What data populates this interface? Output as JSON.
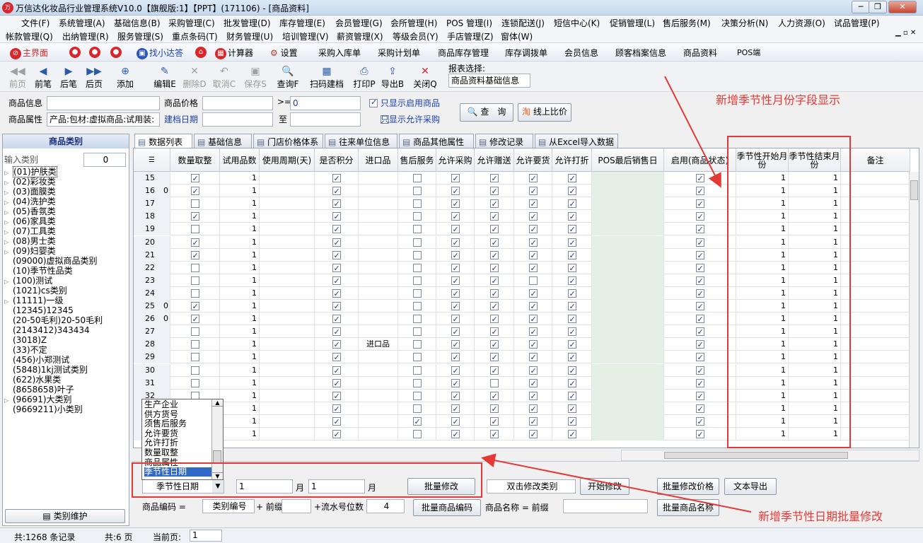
{
  "window": {
    "title": "万信达化妆品行业管理系统V10.0【旗舰版:1】【PPT】(171106) - [商品资料]"
  },
  "menu1": [
    "文件(F)",
    "系统管理(A)",
    "基础信息(B)",
    "采购管理(C)",
    "批发管理(D)",
    "库存管理(E)",
    "会员管理(G)",
    "会所管理(H)",
    "POS 管理(I)",
    "连锁配送(J)",
    "短信中心(K)",
    "促销管理(L)",
    "售后服务(M)",
    "决策分析(N)",
    "人力资源(O)",
    "试品管理(P)"
  ],
  "menu2": [
    "帐款管理(Q)",
    "出纳管理(R)",
    "服务管理(S)",
    "重点条码(T)",
    "财务管理(U)",
    "培训管理(V)",
    "薪资管理(X)",
    "等级会员(Y)",
    "手店管理(Z)",
    "窗体(W)"
  ],
  "quickbar": {
    "home": "主界面",
    "find": "找小达答",
    "calc": "计算器",
    "settings": "设置",
    "items": [
      "采购入库单",
      "采购计划单",
      "商品库存管理",
      "库存调拨单",
      "会员信息",
      "顾客档案信息",
      "商品资料",
      "POS端"
    ]
  },
  "toolbar": {
    "buttons": [
      {
        "label": "前页",
        "icon": "◀◀",
        "disabled": true
      },
      {
        "label": "前笔",
        "icon": "◀",
        "disabled": false
      },
      {
        "label": "后笔",
        "icon": "▶",
        "disabled": false
      },
      {
        "label": "后页",
        "icon": "▶▶",
        "disabled": false
      },
      {
        "label": "添加",
        "icon": "⊕",
        "disabled": false
      },
      {
        "label": "编辑E",
        "icon": "✎",
        "disabled": false
      },
      {
        "label": "删除D",
        "icon": "✕",
        "disabled": true
      },
      {
        "label": "取消C",
        "icon": "↶",
        "disabled": true
      },
      {
        "label": "保存S",
        "icon": "▣",
        "disabled": true
      },
      {
        "label": "查询F",
        "icon": "🔍",
        "disabled": false
      },
      {
        "label": "扫码建档",
        "icon": "▦",
        "disabled": false
      },
      {
        "label": "打印P",
        "icon": "⎙",
        "disabled": false
      },
      {
        "label": "导出B",
        "icon": "⇪",
        "disabled": false
      },
      {
        "label": "关闭Q",
        "icon": "✕",
        "disabled": false
      }
    ],
    "report_label": "报表选择:",
    "report_value": "商品资料基础信息"
  },
  "filters": {
    "goods_info_label": "商品信息",
    "goods_attr_label": "商品属性",
    "goods_attr_value": "产品:包材:虚拟商品:试用装:",
    "price_label": "商品价格",
    "date_label": "建档日期",
    "gte": ">=",
    "price_min": "0",
    "to": "至",
    "only_enabled": "只显示启用商品",
    "only_purchase": "只显示允许采购",
    "query_btn": "查　询",
    "compare_btn": "线上比价"
  },
  "left": {
    "title": "商品类别",
    "search_label": "输入类别",
    "search_value": "0",
    "categories": [
      "(01)护肤类",
      "(02)彩妆类",
      "(03)面膜类",
      "(04)洗护类",
      "(05)香氛类",
      "(06)家具类",
      "(07)工具类",
      "(08)男士类",
      "(09)妇婴类",
      "(09000)虚拟商品类别",
      "(10)季节性品类",
      "(100)测试",
      "(1021)cs类别",
      "(11111)一级",
      "(12345)12345",
      "(20-50毛利)20-50毛利",
      "(2143412)343434",
      "(3018)Z",
      "(33)不定",
      "(456)小郑测试",
      "(5848)1kj测试类别",
      "(622)水果类",
      "(8658658)叶子",
      "(96691)大类别",
      "(9669211)小类别"
    ],
    "maintain_btn": "类别维护"
  },
  "tabs": [
    "数据列表",
    "基础信息",
    "门店价格体系",
    "往来单位信息",
    "商品其他属性",
    "修改记录",
    "从Excel导入数据"
  ],
  "grid": {
    "columns": [
      "",
      "数量取整",
      "试用品数",
      "使用周期(天)",
      "是否积分",
      "进口品",
      "售后服务",
      "允许采购",
      "允许赠送",
      "允许要货",
      "允许打折",
      "POS最后销售日",
      "启用(商品状态)",
      "季节性开始月份",
      "季节性结束月份",
      "备注"
    ],
    "rows": [
      {
        "n": "15",
        "z": "",
        "qty": true,
        "trial": "1",
        "score": true,
        "imp": "",
        "svc": false,
        "pur": true,
        "gift": true,
        "req": true,
        "disc": true,
        "en": true,
        "sm": "1",
        "em": "1"
      },
      {
        "n": "16",
        "z": "0",
        "qty": true,
        "trial": "1",
        "score": true,
        "imp": "",
        "svc": false,
        "pur": true,
        "gift": true,
        "req": true,
        "disc": true,
        "en": true,
        "sm": "1",
        "em": "1"
      },
      {
        "n": "17",
        "z": "",
        "qty": false,
        "trial": "1",
        "score": true,
        "imp": "",
        "svc": false,
        "pur": true,
        "gift": true,
        "req": true,
        "disc": true,
        "en": true,
        "sm": "1",
        "em": "1"
      },
      {
        "n": "18",
        "z": "",
        "qty": true,
        "trial": "1",
        "score": true,
        "imp": "",
        "svc": false,
        "pur": true,
        "gift": true,
        "req": true,
        "disc": true,
        "en": true,
        "sm": "1",
        "em": "1"
      },
      {
        "n": "19",
        "z": "",
        "qty": false,
        "trial": "1",
        "score": true,
        "imp": "",
        "svc": false,
        "pur": true,
        "gift": true,
        "req": true,
        "disc": true,
        "en": true,
        "sm": "1",
        "em": "1"
      },
      {
        "n": "20",
        "z": "",
        "qty": true,
        "trial": "1",
        "score": true,
        "imp": "",
        "svc": false,
        "pur": true,
        "gift": true,
        "req": true,
        "disc": true,
        "en": true,
        "sm": "1",
        "em": "1"
      },
      {
        "n": "21",
        "z": "",
        "qty": true,
        "trial": "1",
        "score": true,
        "imp": "",
        "svc": false,
        "pur": true,
        "gift": true,
        "req": true,
        "disc": true,
        "en": true,
        "sm": "1",
        "em": "1"
      },
      {
        "n": "22",
        "z": "",
        "qty": false,
        "trial": "1",
        "score": true,
        "imp": "",
        "svc": false,
        "pur": true,
        "gift": true,
        "req": true,
        "disc": true,
        "en": true,
        "sm": "1",
        "em": "1"
      },
      {
        "n": "23",
        "z": "",
        "qty": false,
        "trial": "1",
        "score": true,
        "imp": "",
        "svc": false,
        "pur": true,
        "gift": true,
        "req": false,
        "disc": true,
        "en": true,
        "sm": "1",
        "em": "1"
      },
      {
        "n": "24",
        "z": "",
        "qty": false,
        "trial": "1",
        "score": true,
        "imp": "",
        "svc": false,
        "pur": true,
        "gift": true,
        "req": true,
        "disc": true,
        "en": true,
        "sm": "1",
        "em": "1"
      },
      {
        "n": "25",
        "z": "0",
        "qty": true,
        "trial": "1",
        "score": true,
        "imp": "",
        "svc": false,
        "pur": true,
        "gift": true,
        "req": true,
        "disc": true,
        "en": true,
        "sm": "1",
        "em": "1"
      },
      {
        "n": "26",
        "z": "0",
        "qty": true,
        "trial": "1",
        "score": true,
        "imp": "",
        "svc": false,
        "pur": true,
        "gift": true,
        "req": true,
        "disc": true,
        "en": true,
        "sm": "1",
        "em": "1"
      },
      {
        "n": "27",
        "z": "",
        "qty": false,
        "trial": "1",
        "score": true,
        "imp": "",
        "svc": false,
        "pur": true,
        "gift": true,
        "req": true,
        "disc": true,
        "en": true,
        "sm": "1",
        "em": "1"
      },
      {
        "n": "28",
        "z": "",
        "qty": false,
        "trial": "1",
        "score": true,
        "imp": "进口品",
        "svc": false,
        "pur": true,
        "gift": true,
        "req": true,
        "disc": true,
        "en": true,
        "sm": "1",
        "em": "1"
      },
      {
        "n": "29",
        "z": "",
        "qty": false,
        "trial": "1",
        "score": true,
        "imp": "",
        "svc": false,
        "pur": true,
        "gift": true,
        "req": true,
        "disc": true,
        "en": true,
        "sm": "1",
        "em": "1"
      },
      {
        "n": "30",
        "z": "",
        "qty": false,
        "trial": "1",
        "score": true,
        "imp": "",
        "svc": false,
        "pur": true,
        "gift": true,
        "req": true,
        "disc": true,
        "en": true,
        "sm": "1",
        "em": "1"
      },
      {
        "n": "31",
        "z": "",
        "qty": false,
        "trial": "1",
        "score": true,
        "imp": "",
        "svc": false,
        "pur": true,
        "gift": false,
        "req": true,
        "disc": true,
        "en": true,
        "sm": "1",
        "em": "1"
      },
      {
        "n": "32",
        "z": "",
        "qty": false,
        "trial": "1",
        "score": true,
        "imp": "",
        "svc": false,
        "pur": true,
        "gift": true,
        "req": true,
        "disc": true,
        "en": true,
        "sm": "1",
        "em": "1"
      },
      {
        "n": "",
        "z": "",
        "qty": false,
        "trial": "1",
        "score": true,
        "imp": "",
        "svc": false,
        "pur": true,
        "gift": true,
        "req": true,
        "disc": true,
        "en": true,
        "sm": "1",
        "em": "1"
      },
      {
        "n": "",
        "z": "",
        "qty": false,
        "trial": "1",
        "score": true,
        "imp": "",
        "svc": true,
        "pur": true,
        "gift": true,
        "req": true,
        "disc": true,
        "en": true,
        "sm": "1",
        "em": "1"
      },
      {
        "n": "",
        "z": "",
        "qty": false,
        "trial": "1",
        "score": true,
        "imp": "",
        "svc": false,
        "pur": true,
        "gift": true,
        "req": true,
        "disc": true,
        "en": true,
        "sm": "1",
        "em": "1"
      }
    ]
  },
  "dropdown_options": [
    "生产企业",
    "供方货号",
    "须售后服务",
    "允许要货",
    "允许打折",
    "数量取整",
    "商品属性",
    "季节性日期"
  ],
  "batch": {
    "field_select": "季节性日期",
    "month_from": "1",
    "month_unit": "月",
    "month_to": "1",
    "modify_btn": "批量修改",
    "dbl_label": "双击修改类别",
    "start_btn": "开始修改",
    "price_btn": "批量修改价格",
    "export_btn": "文本导出",
    "code_label": "商品编码 =",
    "code_select": "类别编号",
    "prefix_label": "+ 前缀",
    "serial_label": "+流水号位数",
    "serial_value": "4",
    "code_btn": "批量商品编码",
    "name_label": "商品名称 = 前缀",
    "name_btn": "批量商品名称"
  },
  "annotations": {
    "top": "新增季节性月份字段显示",
    "bottom": "新增季节性日期批量修改"
  },
  "status": {
    "records": "共:1268 条记录",
    "pages": "共:6 页",
    "current_label": "当前页:",
    "current_value": "1"
  }
}
